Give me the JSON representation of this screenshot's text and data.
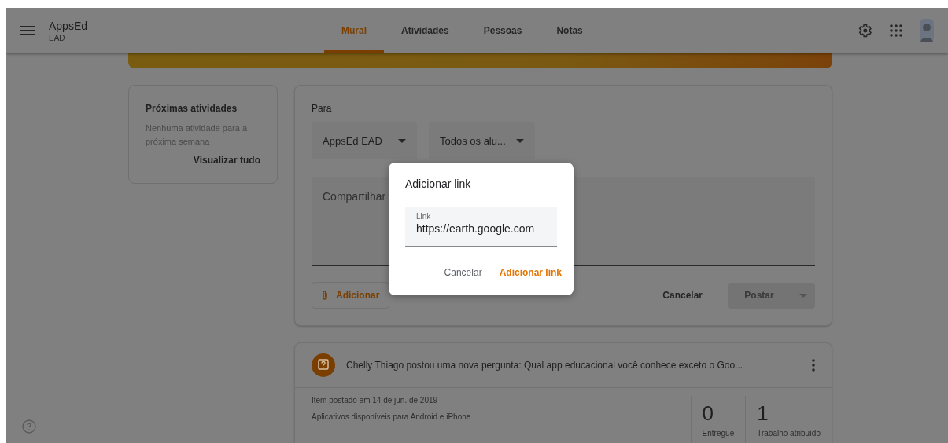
{
  "header": {
    "title": "AppsEd",
    "subtitle": "EAD"
  },
  "tabs": [
    {
      "label": "Mural",
      "selected": true
    },
    {
      "label": "Atividades",
      "selected": false
    },
    {
      "label": "Pessoas",
      "selected": false
    },
    {
      "label": "Notas",
      "selected": false
    }
  ],
  "upcoming": {
    "title": "Próximas atividades",
    "message": "Nenhuma atividade para a próxima semana",
    "link": "Visualizar tudo"
  },
  "composer": {
    "to_label": "Para",
    "class_dropdown": "AppsEd EAD",
    "students_dropdown": "Todos os alu...",
    "placeholder": "Compartilhar",
    "attach_button": "Adicionar",
    "cancel_button": "Cancelar",
    "post_button": {
      "label": "Postar",
      "disabled": true
    }
  },
  "dialog": {
    "title": "Adicionar link",
    "field_label": "Link",
    "field_value": "https://earth.google.com",
    "cancel_button": "Cancelar",
    "confirm_button": "Adicionar link"
  },
  "post": {
    "title": "Chelly Thiago postou uma nova pergunta: Qual app educacional você conhece exceto o Goo...",
    "date": "Item postado em 14 de jun. de 2019",
    "description": "Aplicativos disponíveis para Android e iPhone",
    "stats": [
      {
        "value": "0",
        "label": "Entregue"
      },
      {
        "value": "1",
        "label": "Trabalho atribuído"
      }
    ]
  }
}
